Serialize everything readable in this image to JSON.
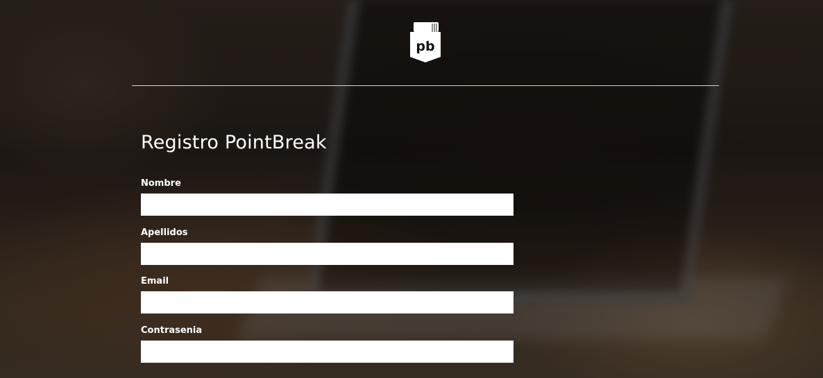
{
  "brand": {
    "logo_text": "pb",
    "logo_icon": "pointbreak-logo-icon"
  },
  "form": {
    "title": "Registro PointBreak",
    "fields": [
      {
        "label": "Nombre",
        "value": "",
        "placeholder": ""
      },
      {
        "label": "Apellidos",
        "value": "",
        "placeholder": ""
      },
      {
        "label": "Email",
        "value": "",
        "placeholder": ""
      },
      {
        "label": "Contrasenia",
        "value": "",
        "placeholder": ""
      }
    ]
  },
  "colors": {
    "text": "#ffffff",
    "input_background": "#ffffff",
    "divider": "#d7d7d7",
    "background": "#1c1612"
  }
}
